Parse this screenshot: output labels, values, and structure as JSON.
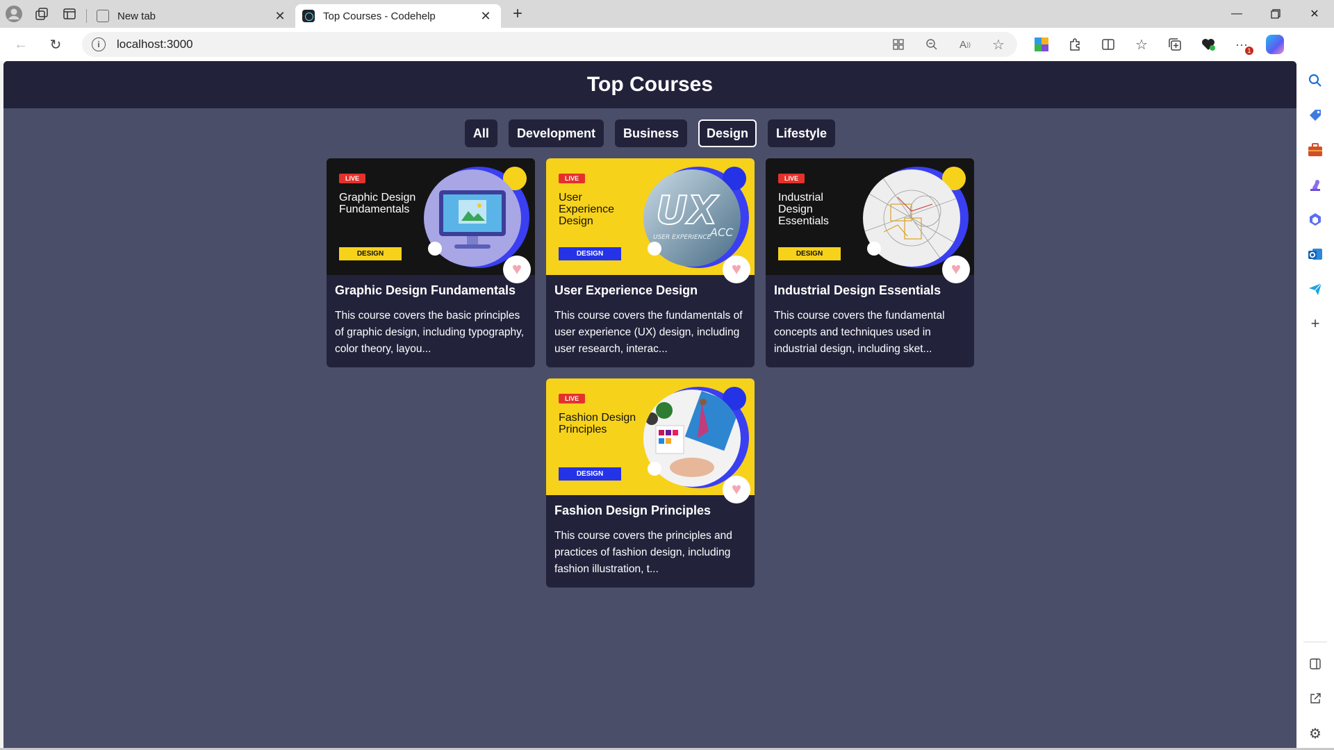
{
  "browser": {
    "tabs": [
      {
        "title": "New tab",
        "active": false
      },
      {
        "title": "Top Courses - Codehelp",
        "active": true
      }
    ],
    "address": "localhost:3000",
    "notification_count": "1"
  },
  "app": {
    "title": "Top Courses",
    "filters": [
      "All",
      "Development",
      "Business",
      "Design",
      "Lifestyle"
    ],
    "active_filter": "Design"
  },
  "courses": [
    {
      "title": "Graphic Design Fundamentals",
      "thumb_title": "Graphic Design Fundamentals",
      "tag": "DESIGN",
      "live": "LIVE",
      "theme": "dark",
      "description": "This course covers the basic principles of graphic design, including typography, color theory, layou..."
    },
    {
      "title": "User Experience Design",
      "thumb_title": "User Experience Design",
      "tag": "DESIGN",
      "live": "LIVE",
      "theme": "yellow",
      "description": "This course covers the fundamentals of user experience (UX) design, including user research, interac..."
    },
    {
      "title": "Industrial Design Essentials",
      "thumb_title": "Industrial Design Essentials",
      "tag": "DESIGN",
      "live": "LIVE",
      "theme": "dark",
      "description": "This course covers the fundamental concepts and techniques used in industrial design, including sket..."
    },
    {
      "title": "Fashion Design Principles",
      "thumb_title": "Fashion Design Principles",
      "tag": "DESIGN",
      "live": "LIVE",
      "theme": "yellow",
      "description": "This course covers the principles and practices of fashion design, including fashion illustration, t..."
    }
  ],
  "colors": {
    "page_bg": "#4a4e69",
    "header_bg": "#22223b",
    "card_bg": "#22223b",
    "thumb_yellow": "#f7d21b",
    "thumb_blue": "#3a3ff2",
    "live_red": "#e4322b"
  },
  "icons": {
    "tabstrip": [
      "profile-icon",
      "workspaces-icon",
      "vertical-tabs-icon"
    ],
    "toolbar": [
      "back-icon",
      "refresh-icon",
      "site-info-icon",
      "app-available-icon",
      "zoom-out-icon",
      "read-aloud-icon",
      "favorite-star-icon",
      "extension-colored-icon",
      "extensions-icon",
      "split-screen-icon",
      "favorites-icon",
      "collections-icon",
      "browser-essentials-icon",
      "more-menu-icon",
      "copilot-icon"
    ],
    "sidepanel": [
      "search-icon",
      "shopping-tag-icon",
      "tools-briefcase-icon",
      "games-icon",
      "copilot-apps-icon",
      "outlook-icon",
      "send-icon",
      "add-icon",
      "sidebar-toggle-icon",
      "open-external-icon",
      "settings-icon"
    ],
    "card": [
      "live-badge-icon",
      "heart-icon"
    ]
  }
}
